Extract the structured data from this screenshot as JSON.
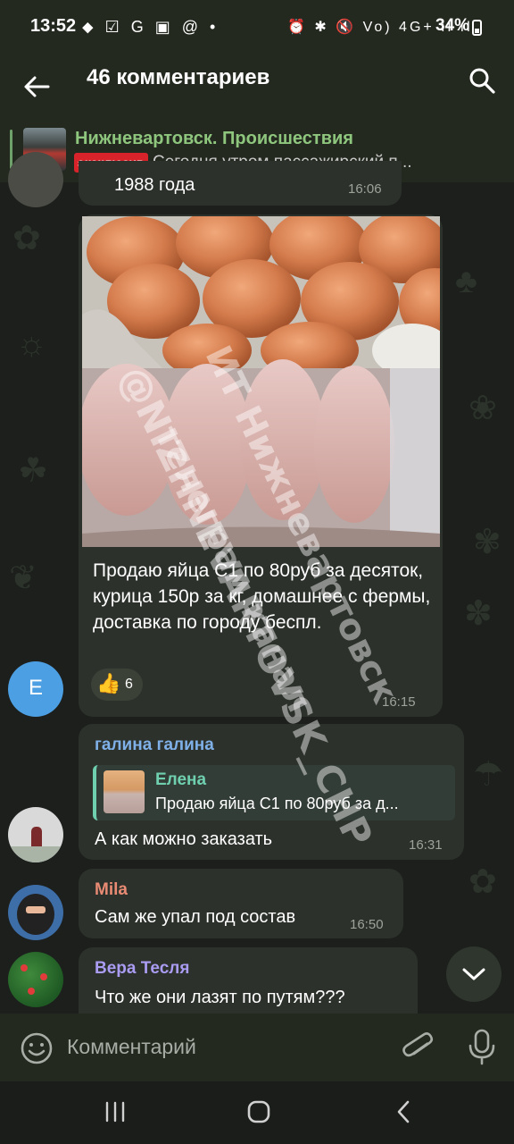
{
  "status_bar": {
    "time": "13:52",
    "left_icons": "⬥ ☑ G ▣ @ •",
    "right_icons": "⏰ ✱ 🔇 Vo) 4G+ ıl ıl",
    "battery": "34%"
  },
  "header": {
    "title": "46 комментариев"
  },
  "pinned": {
    "channel": "Нижневартовск. Происшествия",
    "badge": "эксклюзив",
    "preview": "Сегодня утром пассажирский п..."
  },
  "messages": [
    {
      "partial_text": "1988 года",
      "time": "16:06"
    },
    {
      "text": "Продаю яйца С1 по 80руб за десяток, курица 150р за кг, домашнее с фермы, доставка по городу беспл.",
      "reaction_emoji": "👍",
      "reaction_count": "6",
      "time": "16:15",
      "avatar_letter": "E"
    },
    {
      "sender": "галина галина",
      "reply_name": "Елена",
      "reply_text": "Продаю яйца С1 по 80руб за д...",
      "text": "А как можно заказать",
      "time": "16:31"
    },
    {
      "sender": "Mila",
      "text": "Сам же упал под состав",
      "time": "16:50"
    },
    {
      "sender": "Вера Тесля",
      "text": "Что же они лазят по путям???"
    }
  ],
  "watermark": {
    "line1": "@NIZHNEVARTOVSK_CHP",
    "line2": "ИТ Нижневартовск",
    "line3": "телеграм канал"
  },
  "composer": {
    "placeholder": "Комментарий"
  },
  "colors": {
    "header_bg": "#23291f",
    "pinned_title": "#8fc67e",
    "badge": "#d8232b",
    "sender_galina": "#7fb0e8",
    "sender_mila": "#e98b74",
    "sender_vera": "#a99cf2",
    "reply_name": "#6fd0b0"
  }
}
